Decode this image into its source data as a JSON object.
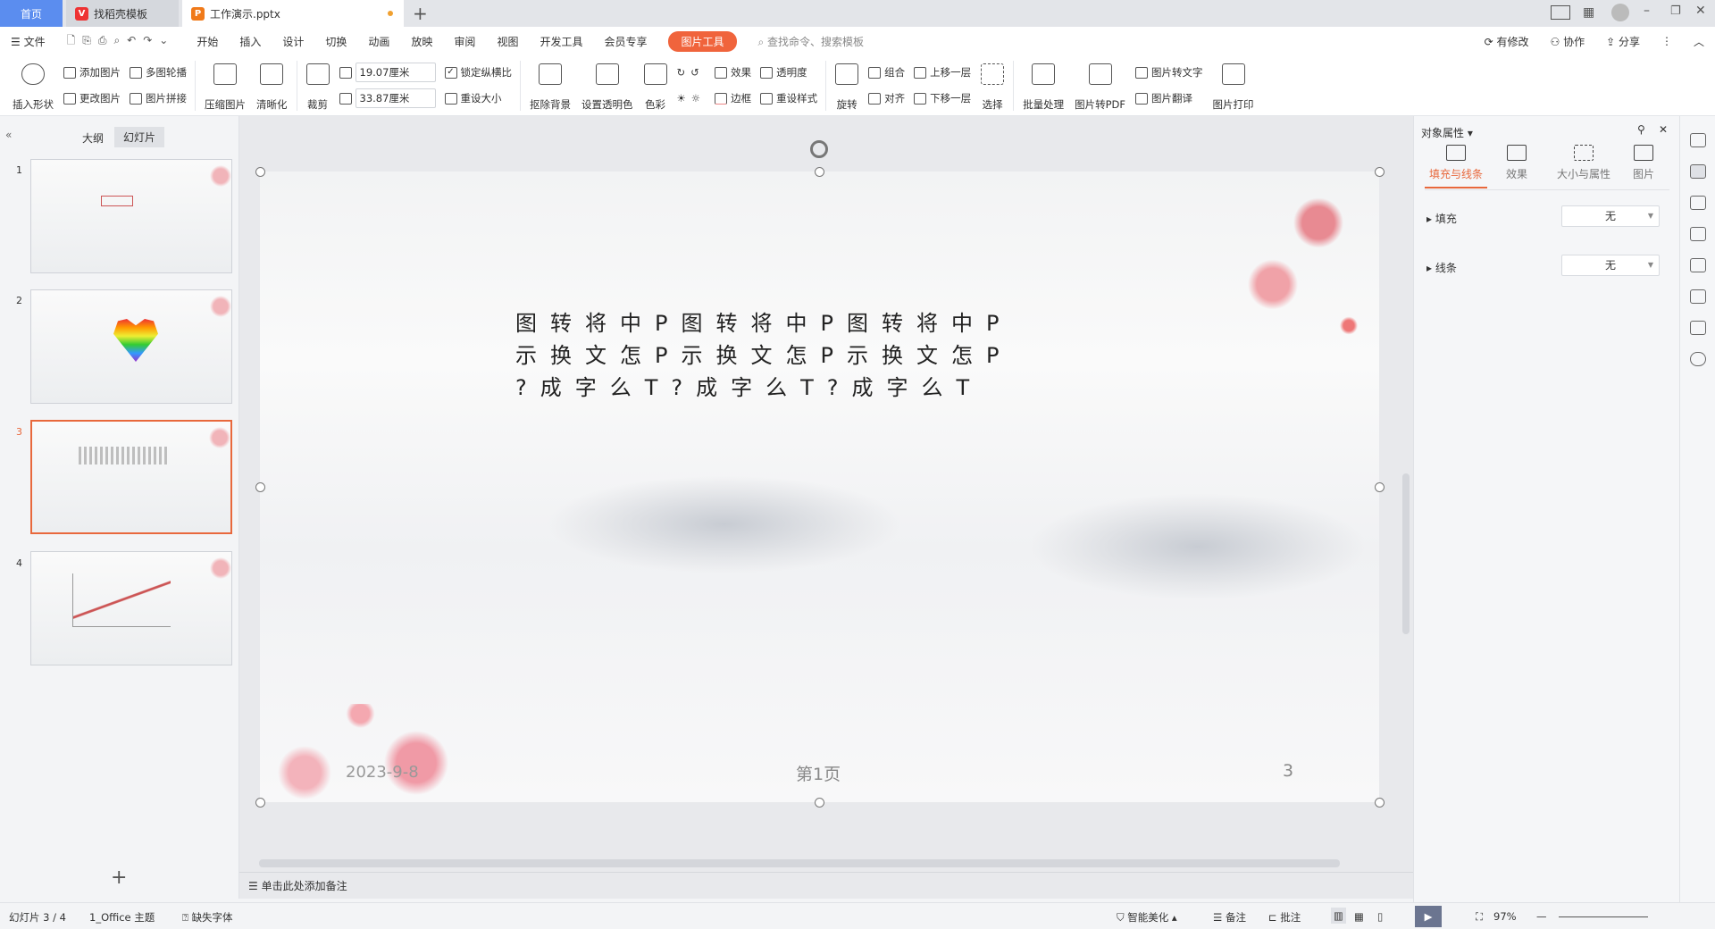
{
  "tabs": [
    {
      "label": "首页"
    },
    {
      "label": "找稻壳模板"
    },
    {
      "label": "工作演示.pptx"
    }
  ],
  "menu": {
    "file": "文件",
    "items": [
      "开始",
      "插入",
      "设计",
      "切换",
      "动画",
      "放映",
      "审阅",
      "视图",
      "开发工具",
      "会员专享"
    ],
    "active": "图片工具",
    "search": "查找命令、搜索模板",
    "modified": "有修改",
    "collab": "协作",
    "share": "分享"
  },
  "ribbon": {
    "insert_shape": "插入形状",
    "add_pic": "添加图片",
    "multi_carousel": "多图轮播",
    "change_pic": "更改图片",
    "pic_stitch": "图片拼接",
    "compress": "压缩图片",
    "sharpen": "清晰化",
    "crop": "裁剪",
    "height": "19.07厘米",
    "width": "33.87厘米",
    "lock_ratio": "锁定纵横比",
    "reset_size": "重设大小",
    "remove_bg": "抠除背景",
    "set_transparent": "设置透明色",
    "color": "色彩",
    "effects": "效果",
    "border": "边框",
    "transparency": "透明度",
    "reset_style": "重设样式",
    "rotate": "旋转",
    "group": "组合",
    "align": "对齐",
    "bring_forward": "上移一层",
    "send_backward": "下移一层",
    "select": "选择",
    "batch": "批量处理",
    "to_pdf": "图片转PDF",
    "to_text": "图片转文字",
    "translate": "图片翻译",
    "print": "图片打印"
  },
  "left": {
    "outline": "大纲",
    "slides": "幻灯片",
    "thumbs": [
      {
        "num": "1"
      },
      {
        "num": "2"
      },
      {
        "num": "3"
      },
      {
        "num": "4"
      }
    ]
  },
  "slide": {
    "lines": [
      "图转将中P图转将中P图转将中P",
      "示换文怎P示换文怎P示换文怎P",
      "?成字么T?成字么T?成字么T"
    ],
    "date": "2023-9-8",
    "page": "第1页",
    "number": "3"
  },
  "notes": "单击此处添加备注",
  "panel": {
    "title": "对象属性",
    "tabs": [
      "填充与线条",
      "效果",
      "大小与属性",
      "图片"
    ],
    "fill": "填充",
    "fill_value": "无",
    "line": "线条",
    "line_value": "无"
  },
  "status": {
    "slide": "幻灯片 3 / 4",
    "theme": "1_Office 主题",
    "font": "缺失字体",
    "beautify": "智能美化",
    "notes": "备注",
    "comment": "批注",
    "zoom": "97%"
  },
  "colors": {
    "accent": "#f0643c",
    "home_tab": "#5b8def",
    "selected_thumb": "#e8683c"
  }
}
